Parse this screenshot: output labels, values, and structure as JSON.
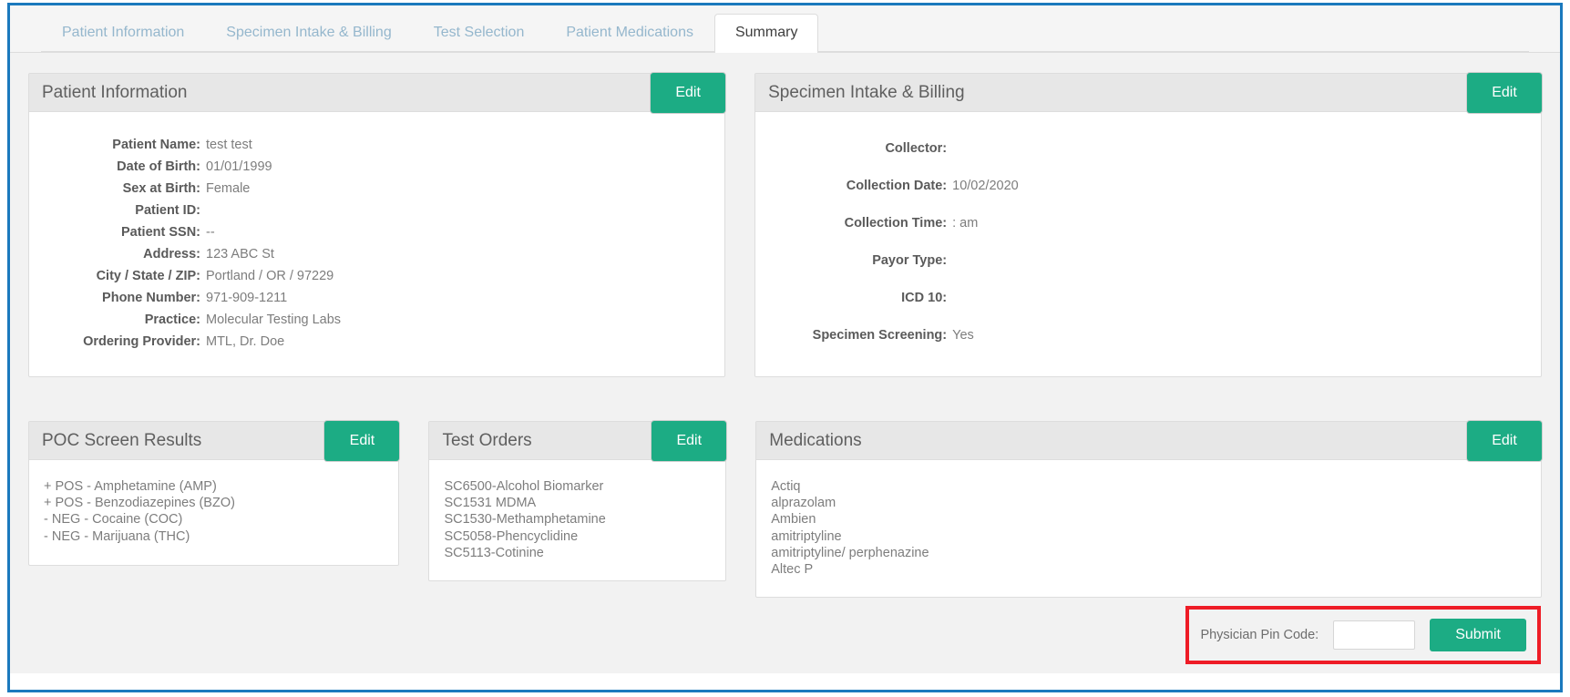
{
  "window": {
    "accent_border": "#1b79bd",
    "brand_green": "#1cac84",
    "highlight_red": "#ee1c26"
  },
  "tabs": [
    {
      "label": "Patient Information",
      "active": false
    },
    {
      "label": "Specimen Intake & Billing",
      "active": false
    },
    {
      "label": "Test Selection",
      "active": false
    },
    {
      "label": "Patient Medications",
      "active": false
    },
    {
      "label": "Summary",
      "active": true
    }
  ],
  "panels": {
    "patient_information": {
      "title": "Patient Information",
      "edit_label": "Edit",
      "fields": [
        {
          "label": "Patient Name:",
          "value": "test test"
        },
        {
          "label": "Date of Birth:",
          "value": "01/01/1999"
        },
        {
          "label": "Sex at Birth:",
          "value": "Female"
        },
        {
          "label": "Patient ID:",
          "value": ""
        },
        {
          "label": "Patient SSN:",
          "value": "--"
        },
        {
          "label": "Address:",
          "value": "123 ABC St"
        },
        {
          "label": "City / State / ZIP:",
          "value": "Portland / OR / 97229"
        },
        {
          "label": "Phone Number:",
          "value": "971-909-1211"
        },
        {
          "label": "Practice:",
          "value": "Molecular Testing Labs"
        },
        {
          "label": "Ordering Provider:",
          "value": "MTL, Dr. Doe"
        }
      ]
    },
    "specimen_intake_billing": {
      "title": "Specimen Intake & Billing",
      "edit_label": "Edit",
      "fields": [
        {
          "label": "Collector:",
          "value": ""
        },
        {
          "label": "Collection Date:",
          "value": "10/02/2020"
        },
        {
          "label": "Collection Time:",
          "value": ": am"
        },
        {
          "label": "Payor Type:",
          "value": ""
        },
        {
          "label": "ICD 10:",
          "value": ""
        },
        {
          "label": "Specimen Screening:",
          "value": "Yes"
        }
      ]
    },
    "poc_screen_results": {
      "title": "POC Screen Results",
      "edit_label": "Edit",
      "items": [
        "+ POS - Amphetamine (AMP)",
        "+ POS - Benzodiazepines (BZO)",
        "- NEG - Cocaine (COC)",
        "- NEG - Marijuana (THC)"
      ]
    },
    "test_orders": {
      "title": "Test Orders",
      "edit_label": "Edit",
      "items": [
        "SC6500-Alcohol Biomarker",
        "SC1531 MDMA",
        "SC1530-Methamphetamine",
        "SC5058-Phencyclidine",
        "SC5113-Cotinine"
      ]
    },
    "medications": {
      "title": "Medications",
      "edit_label": "Edit",
      "items": [
        "Actiq",
        "alprazolam",
        "Ambien",
        "amitriptyline",
        "amitriptyline/ perphenazine",
        "Altec P"
      ]
    }
  },
  "submit_bar": {
    "pin_label": "Physician Pin Code:",
    "pin_value": "",
    "pin_placeholder": "",
    "submit_label": "Submit"
  }
}
